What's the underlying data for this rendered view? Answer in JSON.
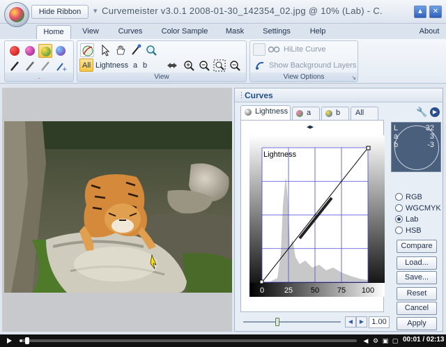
{
  "window": {
    "hide_ribbon_label": "Hide Ribbon",
    "title": "Curvemeister v3.0.1    2008-01-30_142354_02.jpg @ 10% (Lab) - C.",
    "minimize_label": "▲",
    "close_label": "✕"
  },
  "tabs": [
    "Home",
    "View",
    "Curves",
    "Color Sample",
    "Mask",
    "Settings",
    "Help"
  ],
  "active_tab": "Home",
  "about_label": "About",
  "ribbon": {
    "channel_all": "All",
    "channel_lightness": "Lightness",
    "channel_a": "a",
    "channel_b": "b",
    "view_group_label": "View",
    "hilite_curve_label": "HiLite Curve",
    "show_bg_layers_label": "Show Background Layers",
    "view_options_label": "View Options",
    "first_group_label": "."
  },
  "curves_panel": {
    "title": "Curves",
    "tabs": [
      "Lightness",
      "a",
      "b",
      "All"
    ],
    "active_tab": "Lightness",
    "graph_label": "Lightness",
    "x_ticks": [
      "0",
      "25",
      "50",
      "75",
      "100"
    ],
    "readout": {
      "L": {
        "label": "L",
        "value": "32"
      },
      "a": {
        "label": "a",
        "value": "3"
      },
      "b": {
        "label": "b",
        "value": "-3"
      }
    },
    "color_modes": [
      "RGB",
      "WGCMYK",
      "Lab",
      "HSB"
    ],
    "selected_mode": "Lab",
    "buttons": [
      "Compare",
      "Load...",
      "Save...",
      "Reset",
      "Cancel",
      "Apply"
    ],
    "zoom_value": "1.00"
  },
  "chart_data": {
    "type": "line",
    "title": "",
    "xlabel": "",
    "ylabel": "",
    "xlim": [
      0,
      100
    ],
    "ylim": [
      0,
      100
    ],
    "grid": true,
    "series": [
      {
        "x": [
          0,
          100
        ],
        "y": [
          0,
          100
        ]
      }
    ]
  },
  "video": {
    "progress": 0.008,
    "timecode": "00:01 / 02:13"
  },
  "colors": {
    "accent": "#1f4f8a",
    "grid": "#4a4ad8",
    "ribbon_bg": "#e4ebf4"
  }
}
